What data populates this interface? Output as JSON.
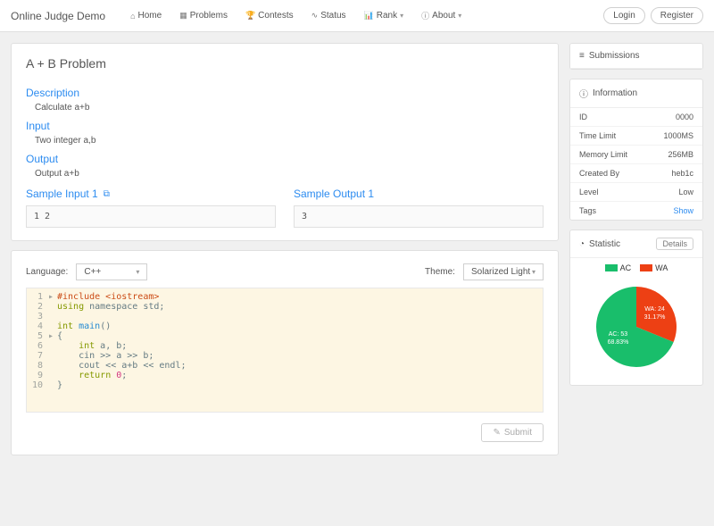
{
  "brand": "Online Judge Demo",
  "nav": {
    "home": "Home",
    "problems": "Problems",
    "contests": "Contests",
    "status": "Status",
    "rank": "Rank",
    "about": "About"
  },
  "auth": {
    "login": "Login",
    "register": "Register"
  },
  "problem": {
    "title": "A + B Problem",
    "desc_h": "Description",
    "desc_b": "Calculate a+b",
    "input_h": "Input",
    "input_b": "Two integer a,b",
    "output_h": "Output",
    "output_b": "Output a+b",
    "sample_in_h": "Sample Input 1",
    "sample_in_b": "1 2",
    "sample_out_h": "Sample Output 1",
    "sample_out_b": "3"
  },
  "editor": {
    "lang_label": "Language:",
    "lang_value": "C++",
    "theme_label": "Theme:",
    "theme_value": "Solarized Light",
    "submit": "Submit",
    "code": [
      {
        "n": "1",
        "fold": "▸",
        "tokens": [
          {
            "c": "tk-pp",
            "t": "#include <iostream>"
          }
        ]
      },
      {
        "n": "2",
        "tokens": [
          {
            "c": "tk-kw",
            "t": "using"
          },
          {
            "t": " namespace std;"
          }
        ]
      },
      {
        "n": "3",
        "tokens": []
      },
      {
        "n": "4",
        "tokens": [
          {
            "c": "tk-kw",
            "t": "int"
          },
          {
            "t": " "
          },
          {
            "c": "tk-fn",
            "t": "main"
          },
          {
            "t": "()"
          }
        ]
      },
      {
        "n": "5",
        "fold": "▸",
        "tokens": [
          {
            "t": "{"
          }
        ]
      },
      {
        "n": "6",
        "tokens": [
          {
            "t": "    "
          },
          {
            "c": "tk-kw",
            "t": "int"
          },
          {
            "t": " a, b;"
          }
        ]
      },
      {
        "n": "7",
        "tokens": [
          {
            "t": "    cin >> a >> b;"
          }
        ]
      },
      {
        "n": "8",
        "tokens": [
          {
            "t": "    cout << a+b << endl;"
          }
        ]
      },
      {
        "n": "9",
        "tokens": [
          {
            "t": "    "
          },
          {
            "c": "tk-kw",
            "t": "return"
          },
          {
            "t": " "
          },
          {
            "c": "tk-num",
            "t": "0"
          },
          {
            "t": ";"
          }
        ]
      },
      {
        "n": "10",
        "tokens": [
          {
            "t": "}"
          }
        ]
      }
    ]
  },
  "side": {
    "submissions": "Submissions",
    "info_h": "Information",
    "info": [
      {
        "k": "ID",
        "v": "0000"
      },
      {
        "k": "Time Limit",
        "v": "1000MS"
      },
      {
        "k": "Memory Limit",
        "v": "256MB"
      },
      {
        "k": "Created By",
        "v": "heb1c"
      },
      {
        "k": "Level",
        "v": "Low"
      },
      {
        "k": "Tags",
        "v": "Show",
        "link": true
      }
    ],
    "stat_h": "Statistic",
    "details": "Details",
    "legend": {
      "ac": "AC",
      "wa": "WA"
    },
    "colors": {
      "ac": "#19be6b",
      "wa": "#ed4014"
    }
  },
  "chart_data": {
    "type": "pie",
    "title": "",
    "series": [
      {
        "name": "AC",
        "value": 53,
        "pct": 68.83,
        "label": "AC: 53\n68.83%",
        "color": "#19be6b"
      },
      {
        "name": "WA",
        "value": 24,
        "pct": 31.17,
        "label": "WA: 24\n31.17%",
        "color": "#ed4014"
      }
    ]
  }
}
